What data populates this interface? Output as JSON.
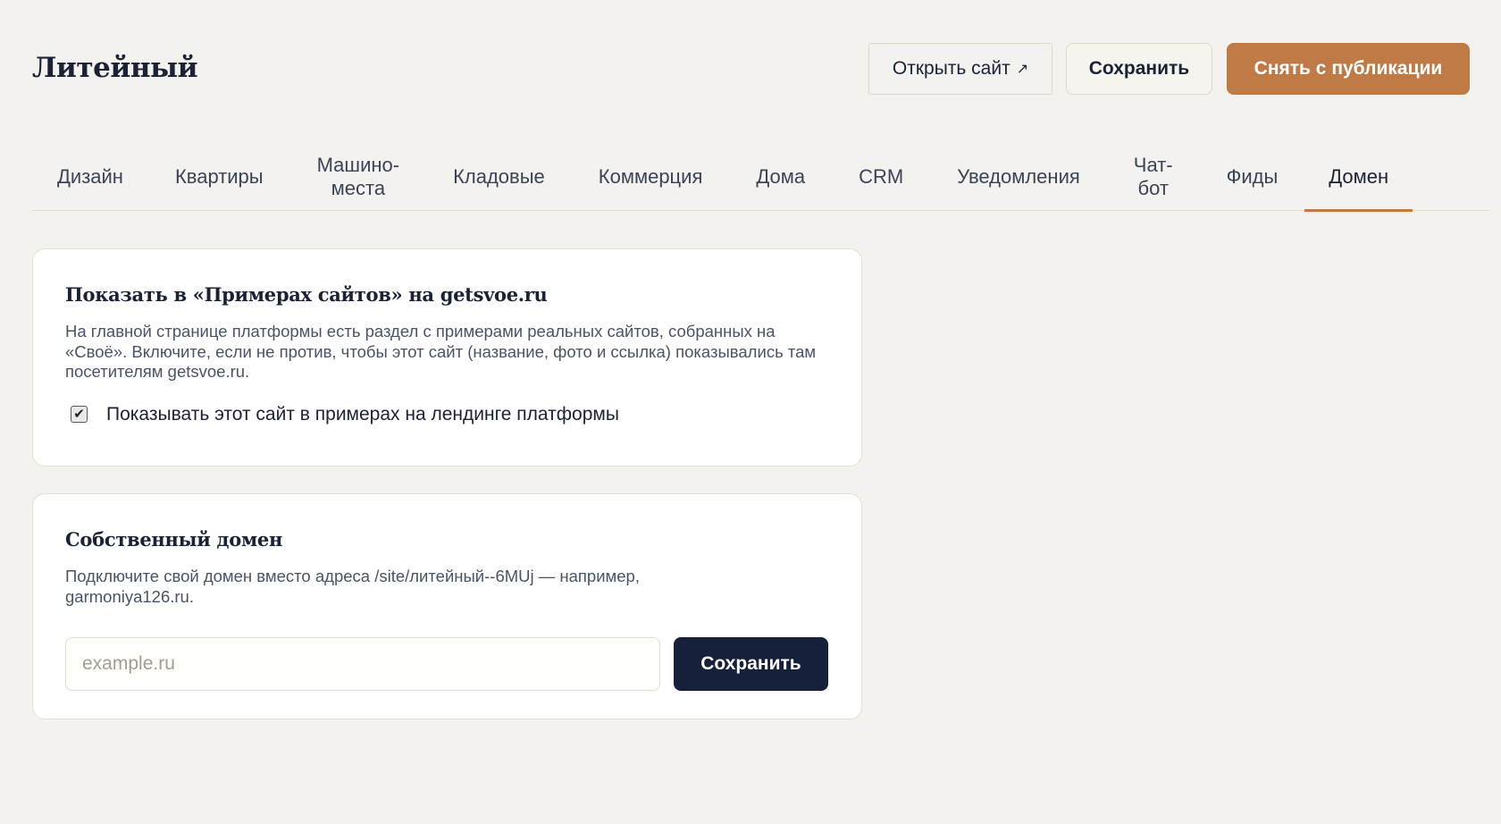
{
  "header": {
    "title": "Литейный",
    "open_site_label": "Открыть сайт",
    "open_site_icon": "external-link-icon",
    "open_site_arrow": "↗",
    "save_label": "Сохранить",
    "unpublish_label": "Снять с публикации"
  },
  "tabs": [
    {
      "label": "Дизайн"
    },
    {
      "label": "Квартиры"
    },
    {
      "label": "Машино-\nместа"
    },
    {
      "label": "Кладовые"
    },
    {
      "label": "Коммерция"
    },
    {
      "label": "Дома"
    },
    {
      "label": "CRM"
    },
    {
      "label": "Уведомления"
    },
    {
      "label": "Чат-\nбот"
    },
    {
      "label": "Фиды"
    },
    {
      "label": "Домен"
    }
  ],
  "active_tab": "Домен",
  "showcase_card": {
    "title": "Показать в «Примерах сайтов» на getsvoe.ru",
    "description": "На главной странице платформы есть раздел с примерами реальных сайтов, собранных на «Своё». Включите, если не против, чтобы этот сайт (название, фото и ссылка) показывались там посетителям getsvoe.ru.",
    "checkbox_label": "Показывать этот сайт в примерах на лендинге платформы",
    "checkbox_checked": true,
    "checkbox_mark": "✔"
  },
  "domain_card": {
    "title": "Собственный домен",
    "description": "Подключите свой домен вместо адреса /site/литейный--6MUj — например, garmoniya126.ru.",
    "input_value": "",
    "input_placeholder": "example.ru",
    "save_label": "Сохранить"
  },
  "colors": {
    "background": "#f4f2ee",
    "accent": "#c07a45",
    "primary_dark": "#17203a"
  }
}
